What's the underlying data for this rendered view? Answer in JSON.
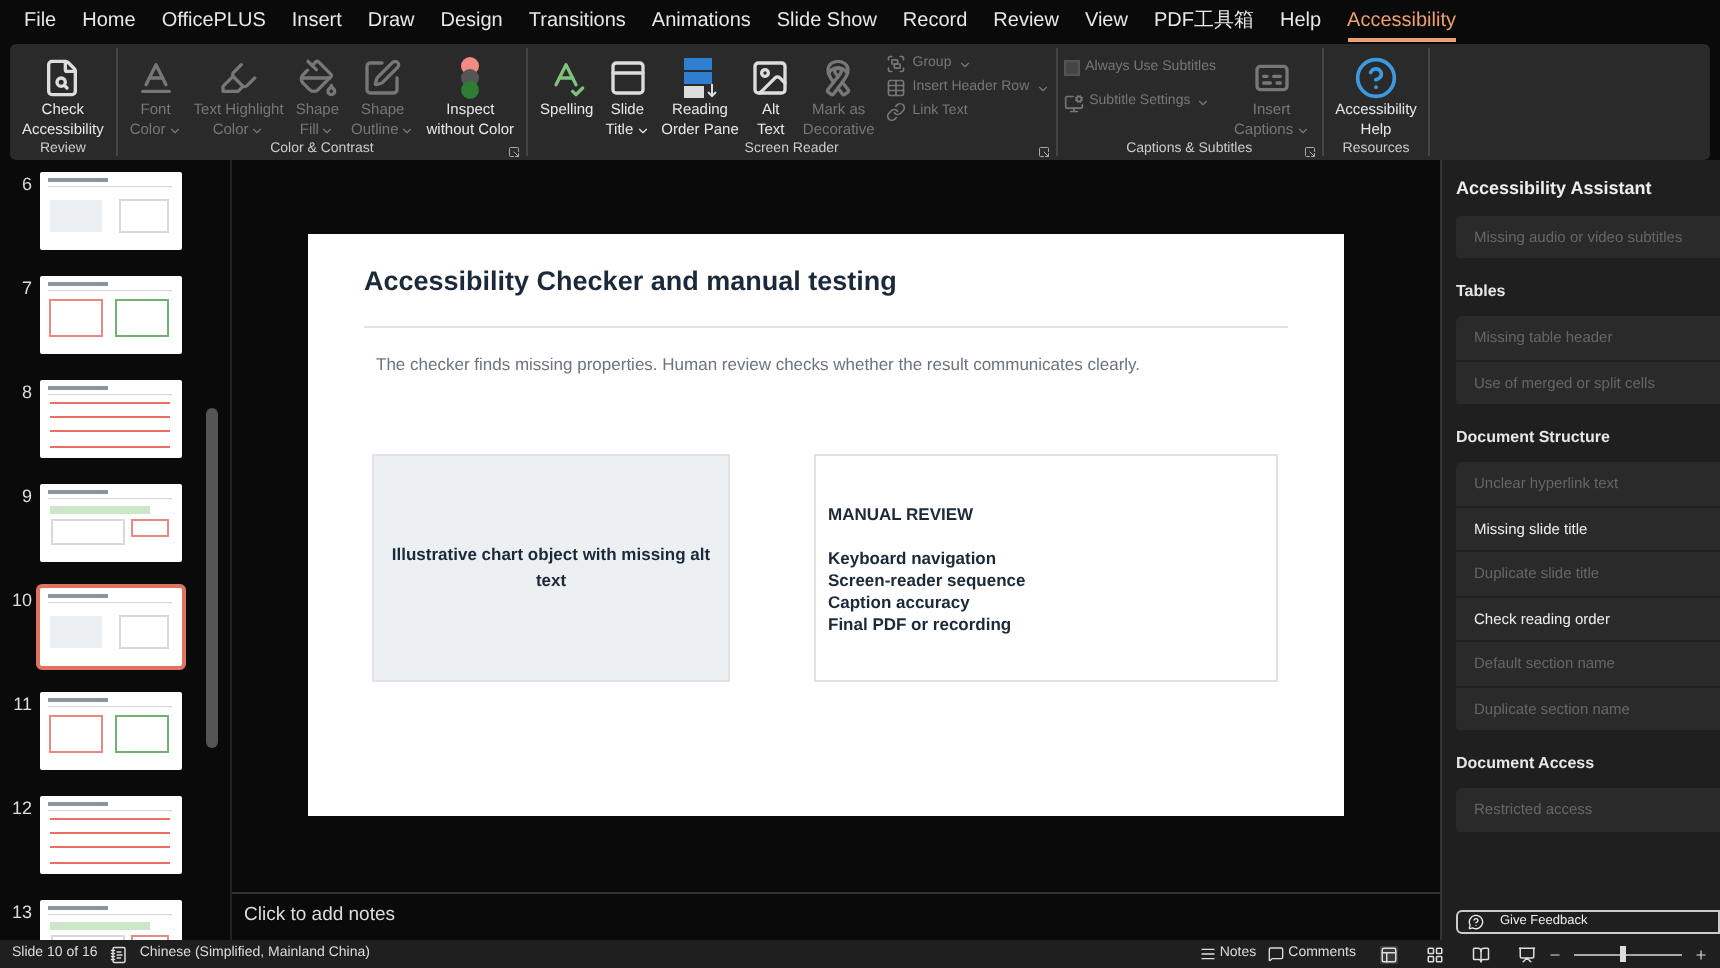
{
  "menu": [
    {
      "label": "File",
      "selected": false
    },
    {
      "label": "Home",
      "selected": false
    },
    {
      "label": "OfficePLUS",
      "selected": false
    },
    {
      "label": "Insert",
      "selected": false
    },
    {
      "label": "Draw",
      "selected": false
    },
    {
      "label": "Design",
      "selected": false
    },
    {
      "label": "Transitions",
      "selected": false
    },
    {
      "label": "Animations",
      "selected": false
    },
    {
      "label": "Slide Show",
      "selected": false
    },
    {
      "label": "Record",
      "selected": false
    },
    {
      "label": "Review",
      "selected": false
    },
    {
      "label": "View",
      "selected": false
    },
    {
      "label": "PDF工具箱",
      "selected": false
    },
    {
      "label": "Help",
      "selected": false
    },
    {
      "label": "Accessibility",
      "selected": true
    }
  ],
  "ribbon": {
    "groups": [
      {
        "label": "Review",
        "launcher": false,
        "controls": [
          {
            "lines": [
              "Check",
              "Accessibility"
            ],
            "disabled": false,
            "dropdown": false
          }
        ]
      },
      {
        "label": "Color & Contrast",
        "launcher": true,
        "controls": [
          {
            "lines": [
              "Font",
              "Color"
            ],
            "disabled": true,
            "dropdown": true
          },
          {
            "lines": [
              "Text Highlight",
              "Color"
            ],
            "disabled": true,
            "dropdown": true
          },
          {
            "lines": [
              "Shape",
              "Fill"
            ],
            "disabled": true,
            "dropdown": true
          },
          {
            "lines": [
              "Shape",
              "Outline"
            ],
            "disabled": true,
            "dropdown": true
          },
          {
            "lines": [
              "Inspect",
              "without Color"
            ],
            "disabled": false,
            "dropdown": false
          }
        ]
      },
      {
        "label": "Screen Reader",
        "launcher": true,
        "controls": [
          {
            "lines": [
              "Spelling"
            ],
            "disabled": false,
            "dropdown": false
          },
          {
            "lines": [
              "Slide",
              "Title"
            ],
            "disabled": false,
            "dropdown": true
          },
          {
            "lines": [
              "Reading",
              "Order Pane"
            ],
            "disabled": false,
            "dropdown": false
          },
          {
            "lines": [
              "Alt",
              "Text"
            ],
            "disabled": false,
            "dropdown": false
          },
          {
            "lines": [
              "Mark as",
              "Decorative"
            ],
            "disabled": true,
            "dropdown": false
          }
        ],
        "small": [
          {
            "label": "Group",
            "disabled": true,
            "dropdown": true
          },
          {
            "label": "Insert Header Row",
            "disabled": true,
            "dropdown": true
          },
          {
            "label": "Link Text",
            "disabled": true,
            "dropdown": false
          }
        ]
      },
      {
        "label": "Captions & Subtitles",
        "launcher": true,
        "checkbox": {
          "label": "Always Use Subtitles",
          "checked": false,
          "disabled": true
        },
        "small": [
          {
            "label": "Subtitle Settings",
            "disabled": true,
            "dropdown": true
          }
        ],
        "controls": [
          {
            "lines": [
              "Insert",
              "Captions"
            ],
            "disabled": true,
            "dropdown": true
          }
        ]
      },
      {
        "label": "Resources",
        "launcher": false,
        "controls": [
          {
            "lines": [
              "Accessibility",
              "Help"
            ],
            "disabled": false,
            "dropdown": false
          }
        ]
      }
    ]
  },
  "thumbnails": [
    {
      "number": "6",
      "selected": false
    },
    {
      "number": "7",
      "selected": false
    },
    {
      "number": "8",
      "selected": false
    },
    {
      "number": "9",
      "selected": false
    },
    {
      "number": "10",
      "selected": true
    },
    {
      "number": "11",
      "selected": false
    },
    {
      "number": "12",
      "selected": false
    },
    {
      "number": "13",
      "selected": false
    }
  ],
  "slide": {
    "title": "Accessibility Checker and manual testing",
    "subtitle": "The checker finds missing properties. Human review checks whether the result communicates clearly.",
    "chart_placeholder": "Illustrative chart object with missing alt text",
    "review": {
      "heading": "MANUAL REVIEW",
      "items": [
        "Keyboard navigation",
        "Screen-reader sequence",
        "Caption accuracy",
        "Final PDF or recording"
      ]
    }
  },
  "notes": {
    "placeholder": "Click to add notes"
  },
  "assistant": {
    "title": "Accessibility Assistant",
    "sections": [
      {
        "items": [
          {
            "label": "Missing audio or video subtitles",
            "disabled": true
          }
        ]
      },
      {
        "heading": "Tables",
        "items": [
          {
            "label": "Missing table header",
            "disabled": true
          },
          {
            "label": "Use of merged or split cells",
            "disabled": true
          }
        ]
      },
      {
        "heading": "Document Structure",
        "items": [
          {
            "label": "Unclear hyperlink text",
            "disabled": true
          },
          {
            "label": "Missing slide title",
            "disabled": false
          },
          {
            "label": "Duplicate slide title",
            "disabled": true
          },
          {
            "label": "Check reading order",
            "disabled": false
          },
          {
            "label": "Default section name",
            "disabled": true
          },
          {
            "label": "Duplicate section name",
            "disabled": true
          }
        ]
      },
      {
        "heading": "Document Access",
        "items": [
          {
            "label": "Restricted access",
            "disabled": true
          }
        ]
      }
    ],
    "feedback": "Give Feedback"
  },
  "status_bar": {
    "slide": "Slide 10 of 16",
    "language": "Chinese (Simplified, Mainland China)",
    "notes": "Notes",
    "comments": "Comments",
    "zoom": {
      "level": 0.45
    }
  }
}
